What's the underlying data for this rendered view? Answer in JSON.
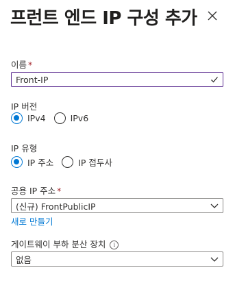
{
  "header": {
    "title": "프런트 엔드 IP 구성 추가",
    "close_icon": "close-icon"
  },
  "name_field": {
    "label": "이름",
    "required_mark": "*",
    "value": "Front-IP",
    "valid_icon": "checkmark-icon"
  },
  "ip_version": {
    "label": "IP 버전",
    "options": [
      "IPv4",
      "IPv6"
    ],
    "selected": "IPv4"
  },
  "ip_type": {
    "label": "IP 유형",
    "options": [
      "IP 주소",
      "IP 접두사"
    ],
    "selected": "IP 주소"
  },
  "public_ip": {
    "label": "공용 IP 주소",
    "required_mark": "*",
    "value": "(신규) FrontPublicIP",
    "create_new_link": "새로 만들기"
  },
  "gateway_lb": {
    "label": "게이트웨이 부하 분산 장치",
    "info_icon": "info-icon",
    "info_glyph": "i",
    "value": "없음"
  },
  "colors": {
    "accent": "#0078d4",
    "focus_border": "#5c2d91",
    "required": "#a4262c"
  }
}
